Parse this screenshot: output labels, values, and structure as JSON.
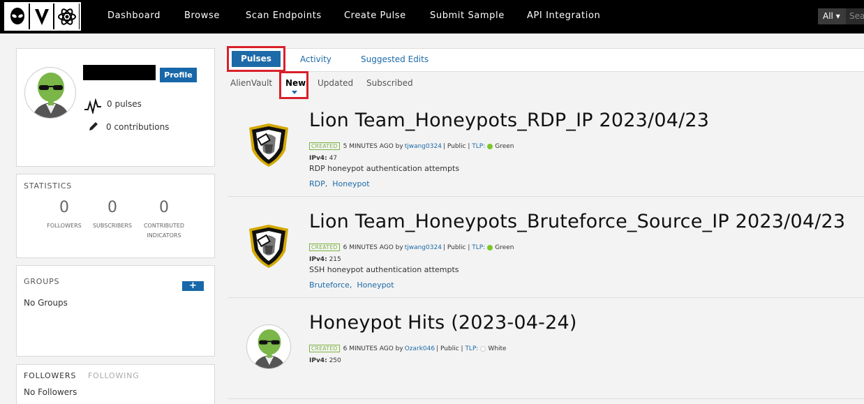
{
  "nav": {
    "links": [
      "Dashboard",
      "Browse",
      "Scan Endpoints",
      "Create Pulse",
      "Submit Sample",
      "API Integration"
    ],
    "search_scope": "All ▾",
    "search_placeholder": "Sea"
  },
  "profile": {
    "button_label": "Profile",
    "pulses": "0 pulses",
    "contributions": "0 contributions"
  },
  "statistics": {
    "title": "STATISTICS",
    "items": [
      {
        "value": "0",
        "label": "FOLLOWERS"
      },
      {
        "value": "0",
        "label": "SUBSCRIBERS"
      },
      {
        "value": "0",
        "label": "CONTRIBUTED INDICATORS"
      }
    ]
  },
  "groups": {
    "title": "GROUPS",
    "add_label": "+",
    "empty": "No Groups"
  },
  "followers": {
    "tab_followers": "FOLLOWERS",
    "tab_following": "FOLLOWING",
    "empty": "No Followers"
  },
  "tabs": [
    "Pulses",
    "Activity",
    "Suggested Edits"
  ],
  "subtabs": [
    "AlienVault",
    "New",
    "Updated",
    "Subscribed"
  ],
  "pulses": [
    {
      "title": "Lion Team_Honeypots_RDP_IP 2023/04/23",
      "badge": "CREATED",
      "time": "5 MINUTES AGO by",
      "author": "tjwang0324",
      "visibility": "Public",
      "tlp_label": "TLP:",
      "tlp_value": "Green",
      "tlp_color": "#7cc62c",
      "ipv4_label": "IPv4:",
      "ipv4_count": "47",
      "description": "RDP honeypot authentication attempts",
      "tags": [
        "RDP",
        "Honeypot"
      ],
      "avatar": "lion-shield-icon"
    },
    {
      "title": "Lion Team_Honeypots_Bruteforce_Source_IP 2023/04/23",
      "badge": "CREATED",
      "time": "6 MINUTES AGO by",
      "author": "tjwang0324",
      "visibility": "Public",
      "tlp_label": "TLP:",
      "tlp_value": "Green",
      "tlp_color": "#7cc62c",
      "ipv4_label": "IPv4:",
      "ipv4_count": "215",
      "description": "SSH honeypot authentication attempts",
      "tags": [
        "Bruteforce",
        "Honeypot"
      ],
      "avatar": "lion-shield-icon"
    },
    {
      "title": "Honeypot Hits (2023-04-24)",
      "badge": "CREATED",
      "time": "6 MINUTES AGO by",
      "author": "Ozark046",
      "visibility": "Public",
      "tlp_label": "TLP:",
      "tlp_value": "White",
      "tlp_color": "#ffffff",
      "ipv4_label": "IPv4:",
      "ipv4_count": "250",
      "description": "",
      "tags": [],
      "avatar": "alien-avatar-icon"
    }
  ],
  "colors": {
    "accent": "#1d6aa8",
    "highlight_border": "#d9202b",
    "created_green": "#7cb342"
  }
}
